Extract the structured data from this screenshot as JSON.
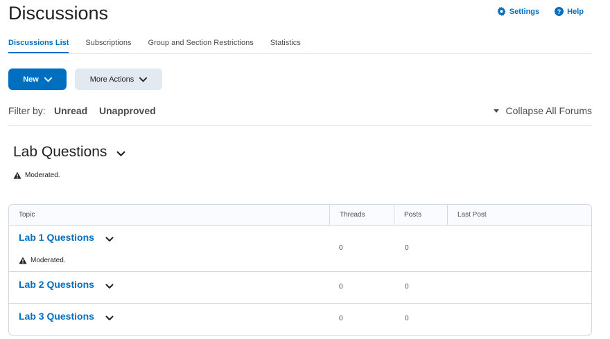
{
  "header": {
    "title": "Discussions",
    "settings_label": "Settings",
    "help_label": "Help"
  },
  "tabs": [
    {
      "label": "Discussions List",
      "active": true
    },
    {
      "label": "Subscriptions",
      "active": false
    },
    {
      "label": "Group and Section Restrictions",
      "active": false
    },
    {
      "label": "Statistics",
      "active": false
    }
  ],
  "actions": {
    "new_label": "New",
    "more_label": "More Actions"
  },
  "filter": {
    "label": "Filter by:",
    "options": [
      "Unread",
      "Unapproved"
    ],
    "collapse_label": "Collapse All Forums"
  },
  "forum": {
    "title": "Lab Questions",
    "status": "Moderated."
  },
  "table": {
    "columns": [
      "Topic",
      "Threads",
      "Posts",
      "Last Post"
    ],
    "rows": [
      {
        "topic": "Lab 1 Questions",
        "status": "Moderated.",
        "threads": "0",
        "posts": "0",
        "last_post": ""
      },
      {
        "topic": "Lab 2 Questions",
        "threads": "0",
        "posts": "0",
        "last_post": ""
      },
      {
        "topic": "Lab 3 Questions",
        "threads": "0",
        "posts": "0",
        "last_post": ""
      }
    ]
  },
  "colors": {
    "accent": "#006fbf",
    "text": "#494c4e",
    "heading": "#202122",
    "border": "#d3d9e3"
  },
  "icons": [
    "gear-icon",
    "help-circle-icon",
    "chevron-down-icon",
    "caret-down-icon",
    "warning-icon"
  ]
}
